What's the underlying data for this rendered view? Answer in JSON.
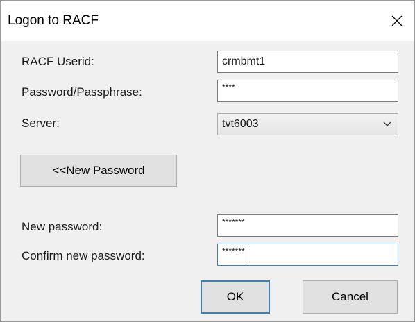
{
  "window": {
    "title": "Logon to RACF"
  },
  "form": {
    "userid_label": "RACF Userid:",
    "userid_value": "crmbmt1",
    "password_label": "Password/Passphrase:",
    "password_mask": "****",
    "server_label": "Server:",
    "server_value": "tvt6003",
    "new_password_button": "<<New Password",
    "new_password_label": "New password:",
    "new_password_mask": "*******",
    "confirm_label": "Confirm new password:",
    "confirm_mask": "*******"
  },
  "buttons": {
    "ok": "OK",
    "cancel": "Cancel"
  },
  "colors": {
    "accent": "#3c7fb1",
    "background": "#f0f0f0"
  }
}
